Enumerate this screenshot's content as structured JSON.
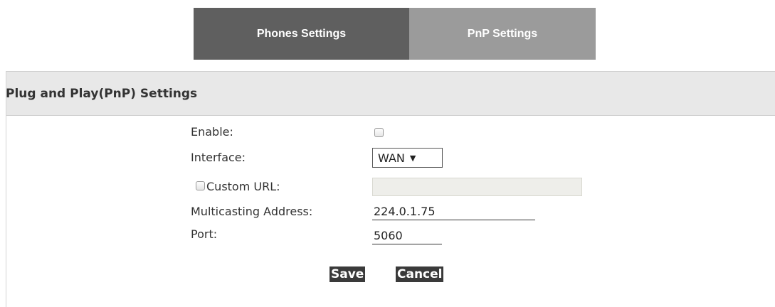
{
  "tabs": [
    {
      "label": "Phones Settings",
      "active": true
    },
    {
      "label": "PnP Settings",
      "active": false
    }
  ],
  "panel": {
    "title": "Plug and Play(PnP) Settings"
  },
  "form": {
    "enable_label": "Enable:",
    "enable_checked": false,
    "interface_label": "Interface:",
    "interface_value": "WAN",
    "custom_url_label": "Custom URL:",
    "custom_url_checked": false,
    "custom_url_value": "",
    "multicast_label": "Multicasting Address:",
    "multicast_value": "224.0.1.75",
    "port_label": "Port:",
    "port_value": "5060"
  },
  "buttons": {
    "save": "Save",
    "cancel": "Cancel"
  },
  "colors": {
    "active_tab": "#5f5f5f",
    "inactive_tab": "#9b9b9b",
    "header_bg": "#e8e8e8",
    "button_bg": "#3a3a3a"
  }
}
